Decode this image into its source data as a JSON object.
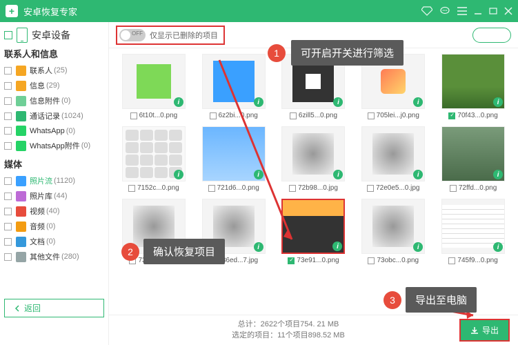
{
  "app": {
    "title": "安卓恢复专家"
  },
  "sidebar": {
    "device_label": "安卓设备",
    "group1": "联系人和信息",
    "group2": "媒体",
    "items1": [
      {
        "label": "联系人",
        "count": "(25)",
        "color": "#f5a623"
      },
      {
        "label": "信息",
        "count": "(29)",
        "color": "#f5a623"
      },
      {
        "label": "信息附件",
        "count": "(0)",
        "color": "#6fcf97"
      },
      {
        "label": "通话记录",
        "count": "(1024)",
        "color": "#2eb872"
      },
      {
        "label": "WhatsApp",
        "count": "(0)",
        "color": "#25d366"
      },
      {
        "label": "WhatsApp附件",
        "count": "(0)",
        "color": "#25d366"
      }
    ],
    "items2": [
      {
        "label": "照片流",
        "count": "(1120)",
        "color": "#3aa0ff",
        "active": true
      },
      {
        "label": "照片库",
        "count": "(44)",
        "color": "#bd6bd6"
      },
      {
        "label": "视频",
        "count": "(40)",
        "color": "#e74c3c"
      },
      {
        "label": "音频",
        "count": "(0)",
        "color": "#f39c12"
      },
      {
        "label": "文档",
        "count": "(0)",
        "color": "#3498db"
      },
      {
        "label": "其他文件",
        "count": "(280)",
        "color": "#95a5a6"
      }
    ]
  },
  "toolbar": {
    "toggle_label": "仅显示已删除的项目"
  },
  "grid": [
    {
      "fn": "6t10t...0.png",
      "ph": "green"
    },
    {
      "fn": "6z2bi...0.png",
      "ph": "blue"
    },
    {
      "fn": "6zill5...0.png",
      "ph": "dark"
    },
    {
      "fn": "705lei...j0.png",
      "ph": "play"
    },
    {
      "fn": "70f43...0.png",
      "ph": "nature",
      "checked": true
    },
    {
      "fn": "7152c...0.png",
      "ph": "icons"
    },
    {
      "fn": "721d6...0.png",
      "ph": "bluegrad"
    },
    {
      "fn": "72b98...0.jpg",
      "ph": "blur"
    },
    {
      "fn": "72e0e5...0.jpg",
      "ph": "blur"
    },
    {
      "fn": "72ffd...0.png",
      "ph": "mount"
    },
    {
      "fn": "732b3...0.jpg",
      "ph": "blur"
    },
    {
      "fn": "736ed...7.jpg",
      "ph": "blur",
      "checked": true
    },
    {
      "fn": "73e91...0.png",
      "ph": "palm",
      "checked": true,
      "sel": true
    },
    {
      "fn": "73obc...0.png",
      "ph": "blur"
    },
    {
      "fn": "745f9...0.png",
      "ph": "lines"
    }
  ],
  "footer": {
    "back": "返回",
    "total": "总计：2622个项目754. 21 MB",
    "selected": "选定的项目：11个项目898.52 MB",
    "export": "导出"
  },
  "callouts": {
    "c1": "可开启开关进行筛选",
    "c2": "确认恢复项目",
    "c3": "导出至电脑"
  }
}
